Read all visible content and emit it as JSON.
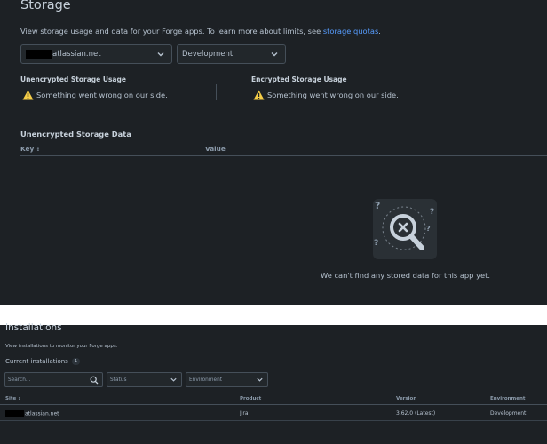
{
  "storage": {
    "title": "Storage",
    "description_prefix": "View storage usage and data for your Forge apps. To learn more about limits, see ",
    "description_link": "storage quotas",
    "description_suffix": ".",
    "site_select_value": "atlassian.net",
    "env_select_value": "Development",
    "unencrypted_title": "Unencrypted Storage Usage",
    "encrypted_title": "Encrypted Storage Usage",
    "error_message": "Something went wrong on our side.",
    "data_title": "Unencrypted Storage Data",
    "col_key": "Key",
    "col_value": "Value",
    "sort_glyph": "↕",
    "empty_message": "We can't find any stored data for this app yet."
  },
  "installations": {
    "title": "Installations",
    "description": "View installations to monitor your Forge apps.",
    "current_label": "Current installations",
    "current_count": "1",
    "search_placeholder": "Search...",
    "status_placeholder": "Status",
    "environment_placeholder": "Environment",
    "columns": {
      "site": "Site",
      "product": "Product",
      "version": "Version",
      "environment": "Environment"
    },
    "sort_glyph": "↕",
    "rows": [
      {
        "site": "atlassian.net",
        "product": "Jira",
        "version": "3.62.0 (Latest)",
        "environment": "Development"
      }
    ]
  },
  "colors": {
    "background": "#1d2125",
    "link": "#579dff",
    "warning": "#f5cd47",
    "border": "#454f59",
    "gap": "#ffffff"
  }
}
